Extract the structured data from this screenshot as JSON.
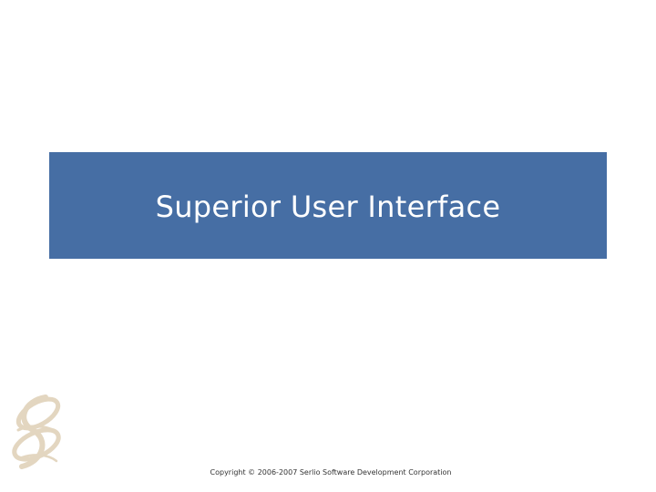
{
  "slide": {
    "title": "Superior User Interface",
    "footer": "Copyright © 2006-2007 Serlio Software Development Corporation",
    "logo_icon": "serlio-swirl-logo-icon"
  },
  "colors": {
    "banner": "#466ea4",
    "title_text": "#ffffff",
    "logo": "#e3d6c0",
    "footer_text": "#333333"
  }
}
